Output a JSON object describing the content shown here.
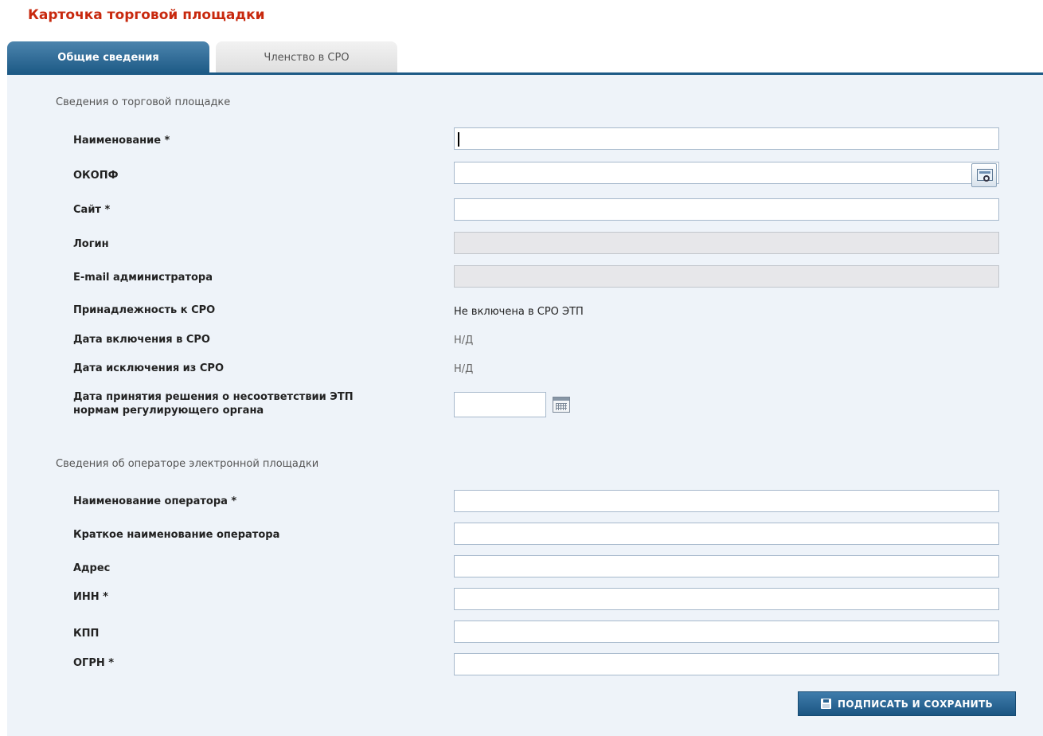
{
  "page": {
    "title": "Карточка торговой площадки"
  },
  "tabs": [
    {
      "label": "Общие сведения",
      "active": true
    },
    {
      "label": "Членство в СРО",
      "active": false
    }
  ],
  "platform_section": {
    "title": "Сведения о торговой площадке",
    "fields": {
      "name": {
        "label": "Наименование *",
        "value": ""
      },
      "okopf": {
        "label": "ОКОПФ",
        "value": "",
        "lookup_icon": "lookup-icon"
      },
      "site": {
        "label": "Сайт *",
        "value": ""
      },
      "login": {
        "label": "Логин",
        "value": "",
        "disabled": true
      },
      "admin_email": {
        "label": "E-mail администратора",
        "value": "",
        "disabled": true
      },
      "sro_membership": {
        "label": "Принадлежность к СРО",
        "value": "Не включена в СРО ЭТП"
      },
      "sro_inclusion_date": {
        "label": "Дата включения в СРО",
        "value": "Н/Д"
      },
      "sro_exclusion_date": {
        "label": "Дата исключения из СРО",
        "value": "Н/Д"
      },
      "noncompliance_date": {
        "label_line1": "Дата принятия решения о несоответствии ЭТП",
        "label_line2": "нормам регулирующего органа",
        "value": "",
        "calendar_icon": "calendar-icon"
      }
    }
  },
  "operator_section": {
    "title": "Сведения об операторе электронной площадки",
    "fields": {
      "operator_name": {
        "label": "Наименование оператора *",
        "value": ""
      },
      "operator_short_name": {
        "label": "Краткое наименование оператора",
        "value": ""
      },
      "address": {
        "label": "Адрес",
        "value": ""
      },
      "inn": {
        "label": "ИНН *",
        "value": ""
      },
      "kpp": {
        "label": "КПП",
        "value": ""
      },
      "ogrn": {
        "label": "ОГРН *",
        "value": ""
      }
    }
  },
  "actions": {
    "sign_save_label": "ПОДПИСАТЬ И СОХРАНИТЬ",
    "sign_save_icon": "save-icon"
  },
  "colors": {
    "title": "#c8290e",
    "tab_active": "#1d5a86",
    "panel_bg": "#eef3f9",
    "button": "#2a6594"
  }
}
